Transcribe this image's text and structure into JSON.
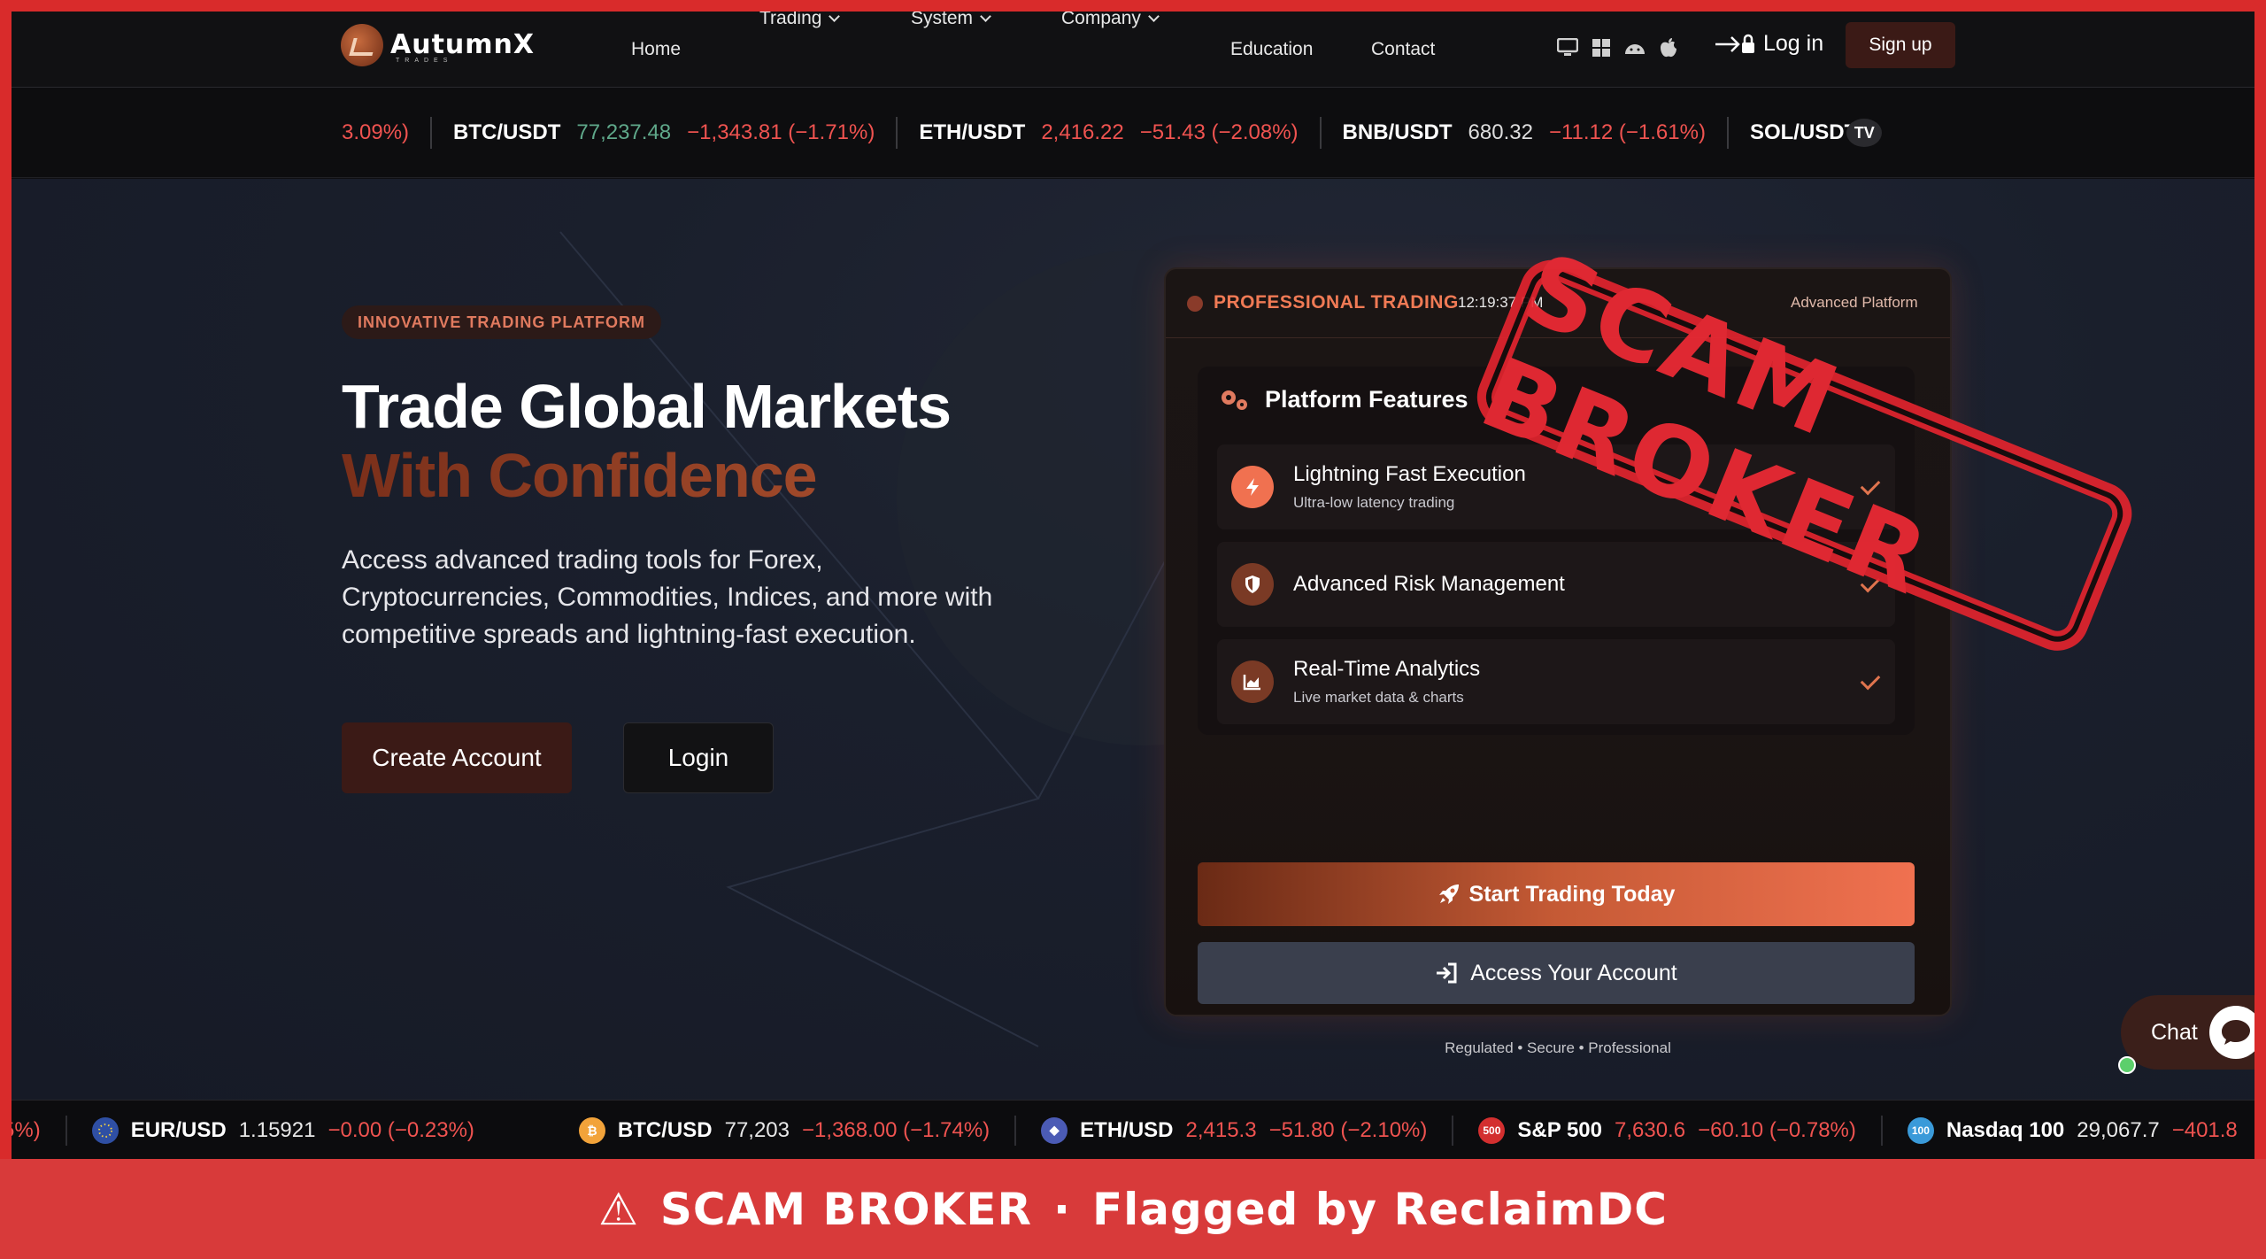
{
  "brand": {
    "name": "AutumnX",
    "sub": "TRADES"
  },
  "nav": {
    "items": [
      {
        "label": "Home",
        "dropdown": false
      },
      {
        "label": "Trading",
        "dropdown": true
      },
      {
        "label": "System",
        "dropdown": true
      },
      {
        "label": "Company",
        "dropdown": true
      },
      {
        "label": "Education",
        "dropdown": false
      },
      {
        "label": "Contact",
        "dropdown": false
      }
    ],
    "platform_icons": [
      "desktop-icon",
      "windows-icon",
      "android-icon",
      "apple-icon"
    ],
    "login_label": "Log in",
    "signup_label": "Sign up"
  },
  "ticker_top": [
    {
      "symbol": "",
      "price": "",
      "change": "3.09%)",
      "dir": "down"
    },
    {
      "symbol": "BTC/USDT",
      "price": "77,237.48",
      "change": "−1,343.81 (−1.71%)",
      "dir": "up"
    },
    {
      "symbol": "ETH/USDT",
      "price": "2,416.22",
      "change": "−51.43 (−2.08%)",
      "dir": "down"
    },
    {
      "symbol": "BNB/USDT",
      "price": "680.32",
      "change": "−11.12 (−1.61%)",
      "dir": "plain"
    },
    {
      "symbol": "SOL/USDT",
      "price": "",
      "change": "",
      "dir": "plain"
    }
  ],
  "hero": {
    "badge": "INNOVATIVE TRADING PLATFORM",
    "title_line1": "Trade Global Markets",
    "title_line2": "With Confidence",
    "lead": "Access advanced trading tools for Forex, Cryptocurrencies, Commodities, Indices, and more with competitive spreads and lightning-fast execution.",
    "create_label": "Create Account",
    "login_label": "Login"
  },
  "card": {
    "label": "PROFESSIONAL TRADING",
    "time": "12:19:37 PM",
    "right_label": "Advanced Platform",
    "features_title": "Platform Features",
    "features": [
      {
        "name": "Lightning Fast Execution",
        "sub": "Ultra-low latency trading",
        "icon": "bolt-icon"
      },
      {
        "name": "Advanced Risk Management",
        "sub": "",
        "icon": "shield-icon"
      },
      {
        "name": "Real-Time Analytics",
        "sub": "Live market data & charts",
        "icon": "chart-icon"
      }
    ],
    "start_label": "Start Trading Today",
    "access_label": "Access Your Account",
    "tagline": "Regulated • Secure • Professional"
  },
  "chat": {
    "label": "Chat"
  },
  "ticker_bottom": [
    {
      "symbol": "",
      "price": "",
      "change": "5%)",
      "icon": "",
      "color": ""
    },
    {
      "symbol": "EUR/USD",
      "price": "1.15921",
      "change": "−0.00 (−0.23%)",
      "icon": "eu-flag-icon",
      "color": "#2f4fa3",
      "badge": ""
    },
    {
      "symbol": "BTC/USD",
      "price": "77,203",
      "change": "−1,368.00 (−1.74%)",
      "icon": "bitcoin-icon",
      "color": "#f2a33a",
      "badge": "₿"
    },
    {
      "symbol": "ETH/USD",
      "price": "2,415.3",
      "change": "−51.80 (−2.10%)",
      "icon": "ethereum-icon",
      "color": "#4b5bb5",
      "badge": "◆"
    },
    {
      "symbol": "S&P 500",
      "price": "7,630.6",
      "change": "−60.10 (−0.78%)",
      "icon": "sp500-icon",
      "color": "#d32f2f",
      "badge": "500"
    },
    {
      "symbol": "Nasdaq 100",
      "price": "29,067.7",
      "change": "−401.8",
      "icon": "nasdaq-icon",
      "color": "#3a9ad9",
      "badge": "100"
    }
  ],
  "stamp": {
    "text": "SCAM BROKER"
  },
  "banner": {
    "icon": "⚠",
    "text": "SCAM BROKER",
    "separator": "·",
    "flag": "Flagged by ReclaimDC"
  },
  "colors": {
    "accent": "#e07a5f",
    "danger": "#d83a3a",
    "up": "#5fa88a",
    "down": "#ef5350"
  }
}
